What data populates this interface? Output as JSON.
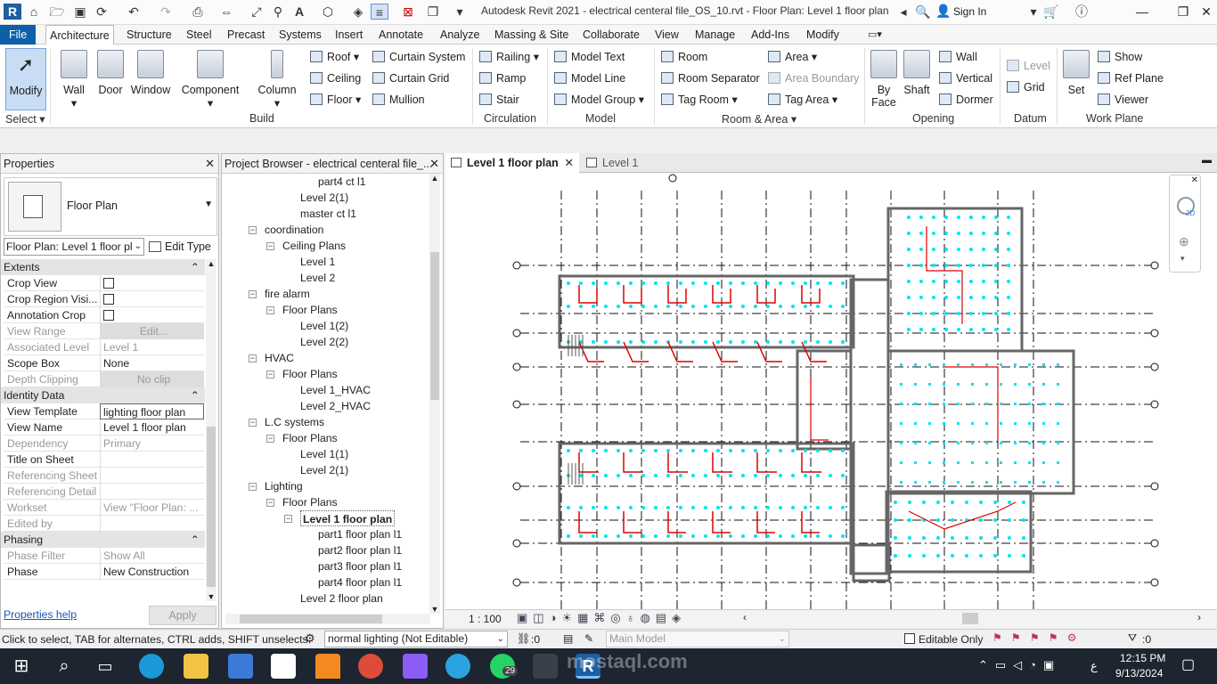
{
  "title_bar": {
    "app_title": "Autodesk Revit 2021 - electrical centeral file_OS_10.rvt - Floor Plan: Level 1 floor plan",
    "sign_in": "Sign In"
  },
  "ribbon_tabs": [
    "File",
    "Architecture",
    "Structure",
    "Steel",
    "Precast",
    "Systems",
    "Insert",
    "Annotate",
    "Analyze",
    "Massing & Site",
    "Collaborate",
    "View",
    "Manage",
    "Add-Ins",
    "Modify"
  ],
  "ribbon": {
    "select": {
      "modify": "Modify",
      "panel": "Select"
    },
    "build": {
      "wall": "Wall",
      "door": "Door",
      "window": "Window",
      "component": "Component",
      "column": "Column",
      "roof": "Roof",
      "ceiling": "Ceiling",
      "floor": "Floor",
      "curtain_system": "Curtain System",
      "curtain_grid": "Curtain Grid",
      "mullion": "Mullion",
      "panel": "Build"
    },
    "circulation": {
      "railing": "Railing",
      "ramp": "Ramp",
      "stair": "Stair",
      "panel": "Circulation"
    },
    "model": {
      "model_text": "Model Text",
      "model_line": "Model Line",
      "model_group": "Model Group",
      "panel": "Model"
    },
    "room_area": {
      "room": "Room",
      "room_separator": "Room Separator",
      "tag_room": "Tag Room",
      "area": "Area",
      "area_boundary": "Area Boundary",
      "tag_area": "Tag Area",
      "panel": "Room & Area"
    },
    "opening": {
      "by_face": "By Face",
      "shaft": "Shaft",
      "wall": "Wall",
      "vertical": "Vertical",
      "dormer": "Dormer",
      "panel": "Opening"
    },
    "datum": {
      "level": "Level",
      "grid": "Grid",
      "panel": "Datum"
    },
    "work_plane": {
      "set": "Set",
      "show": "Show",
      "ref_plane": "Ref Plane",
      "viewer": "Viewer",
      "panel": "Work Plane"
    }
  },
  "properties": {
    "header": "Properties",
    "type_name": "Floor Plan",
    "view_selector": "Floor Plan: Level 1 floor pl",
    "edit_type": "Edit Type",
    "groups": {
      "extents": "Extents",
      "identity": "Identity Data",
      "phasing": "Phasing"
    },
    "rows": {
      "crop_view": "Crop View",
      "crop_region_visible": "Crop Region Visi...",
      "annotation_crop": "Annotation Crop",
      "view_range": "View Range",
      "view_range_val": "Edit...",
      "associated_level": "Associated Level",
      "associated_level_val": "Level 1",
      "scope_box": "Scope Box",
      "scope_box_val": "None",
      "depth_clipping": "Depth Clipping",
      "depth_clipping_val": "No clip",
      "view_template": "View Template",
      "view_template_val": "lighting floor plan",
      "view_name": "View Name",
      "view_name_val": "Level 1 floor plan",
      "dependency": "Dependency",
      "dependency_val": "Primary",
      "title_on_sheet": "Title on Sheet",
      "referencing_sheet": "Referencing Sheet",
      "referencing_detail": "Referencing Detail",
      "workset": "Workset",
      "workset_val": "View \"Floor Plan: ...",
      "edited_by": "Edited by",
      "phase_filter": "Phase Filter",
      "phase_filter_val": "Show All",
      "phase": "Phase",
      "phase_val": "New Construction"
    },
    "help": "Properties help",
    "apply": "Apply"
  },
  "browser": {
    "header": "Project Browser - electrical centeral file_...",
    "items": [
      "part4 ct l1",
      "Level 2(1)",
      "master ct l1",
      "coordination",
      "Ceiling Plans",
      "Level 1",
      "Level 2",
      "fire alarm",
      "Floor Plans",
      "Level 1(2)",
      "Level 2(2)",
      "HVAC",
      "Floor Plans",
      "Level 1_HVAC",
      "Level 2_HVAC",
      "L.C systems",
      "Floor Plans",
      "Level 1(1)",
      "Level 2(1)",
      "Lighting",
      "Floor Plans",
      "Level 1 floor plan",
      "part1 floor plan l1",
      "part2 floor plan l1",
      "part3 floor plan l1",
      "part4 floor plan l1",
      "Level 2 floor plan"
    ]
  },
  "view": {
    "tab_active": "Level 1 floor plan",
    "tab_other": "Level 1",
    "scale": "1 : 100",
    "nav_2d": "2D"
  },
  "status": {
    "hint": "Click to select, TAB for alternates, CTRL adds, SHIFT unselects.",
    "workset": "normal lighting (Not Editable)",
    "count": ":0",
    "model": "Main Model",
    "editable_only": "Editable Only",
    "filter_count": ":0"
  },
  "taskbar": {
    "time": "12:15 PM",
    "date": "9/13/2024",
    "lang": "ع",
    "badge": "29",
    "watermark": "mostaql.com"
  },
  "colors": {
    "accent": "#0d5fa7",
    "cyan": "#00e5ee",
    "red": "#e00000"
  }
}
